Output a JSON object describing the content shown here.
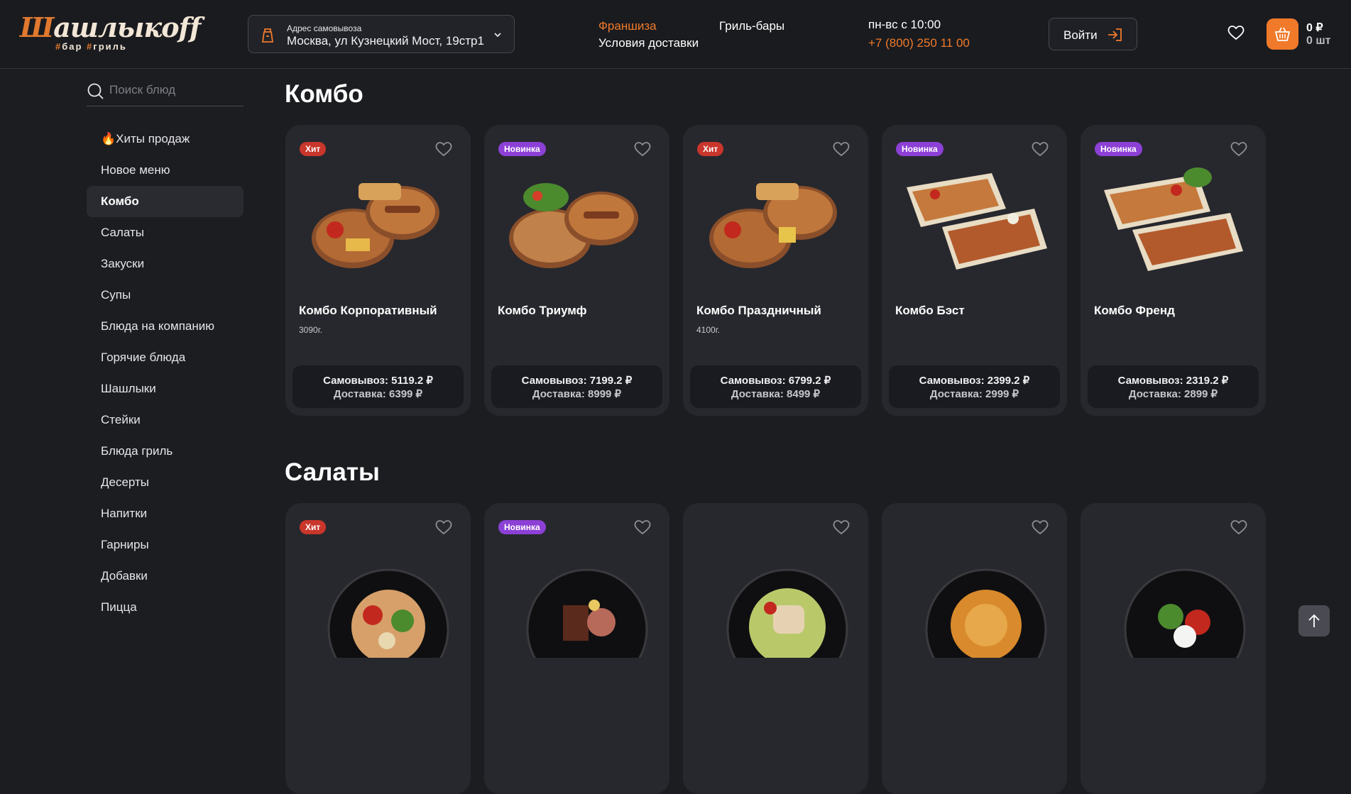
{
  "header": {
    "logo_text": "Шашлыкoff",
    "logo_sub": "#бар #гриль",
    "address_label": "Адрес самовывоза",
    "address_value": "Москва, ул Кузнецкий Мост, 19стр1",
    "nav": {
      "franchise": "Франшиза",
      "delivery": "Условия доставки",
      "grill_bars": "Гриль-бары",
      "hours": "пн-вс с 10:00",
      "phone": "+7 (800) 250 11 00"
    },
    "login_label": "Войти",
    "cart_sum": "0 ₽",
    "cart_count": "0 шт"
  },
  "search": {
    "placeholder": "Поиск блюд"
  },
  "categories": [
    "🔥Хиты продаж",
    "Новое меню",
    "Комбо",
    "Салаты",
    "Закуски",
    "Супы",
    "Блюда на компанию",
    "Горячие блюда",
    "Шашлыки",
    "Стейки",
    "Блюда гриль",
    "Десерты",
    "Напитки",
    "Гарниры",
    "Добавки",
    "Пицца"
  ],
  "active_category": "Комбо",
  "sections": [
    {
      "title": "Комбо",
      "cards": [
        {
          "badge": "Хит",
          "name": "Комбо Корпоративный",
          "weight": "3090г.",
          "pickup": "Самовывоз: 5119.2 ₽",
          "delivery": "Доставка: 6399 ₽"
        },
        {
          "badge": "Новинка",
          "name": "Комбо Триумф",
          "weight": "",
          "pickup": "Самовывоз: 7199.2 ₽",
          "delivery": "Доставка: 8999 ₽"
        },
        {
          "badge": "Хит",
          "name": "Комбо Праздничный",
          "weight": "4100г.",
          "pickup": "Самовывоз: 6799.2 ₽",
          "delivery": "Доставка: 8499 ₽"
        },
        {
          "badge": "Новинка",
          "name": "Комбо Бэст",
          "weight": "",
          "pickup": "Самовывоз: 2399.2 ₽",
          "delivery": "Доставка: 2999 ₽"
        },
        {
          "badge": "Новинка",
          "name": "Комбо Френд",
          "weight": "",
          "pickup": "Самовывоз: 2319.2 ₽",
          "delivery": "Доставка: 2899 ₽"
        }
      ]
    },
    {
      "title": "Салаты",
      "cards": [
        {
          "badge": "Хит"
        },
        {
          "badge": "Новинка"
        },
        {
          "badge": ""
        },
        {
          "badge": ""
        },
        {
          "badge": ""
        }
      ]
    }
  ],
  "colors": {
    "accent": "#f07a2a",
    "hit": "#c9362b",
    "new": "#8c40d6",
    "background": "#1c1d21",
    "card": "#27282e"
  }
}
